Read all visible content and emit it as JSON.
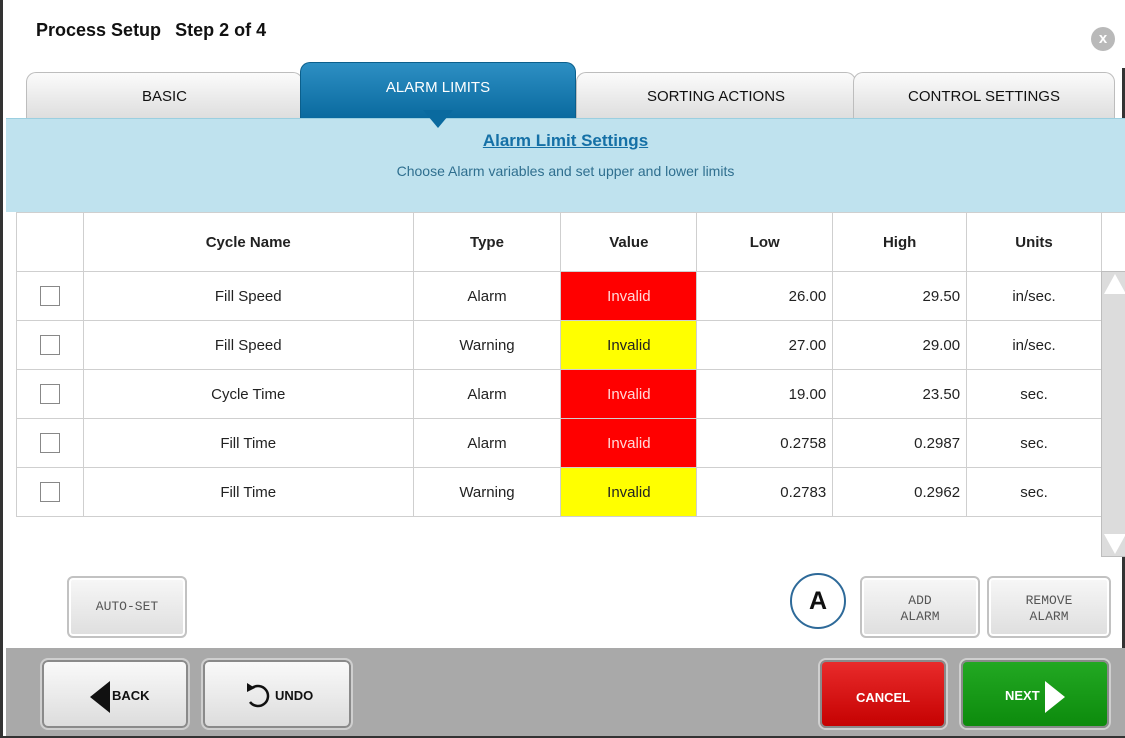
{
  "window": {
    "title": "Process Setup",
    "step": "Step 2 of 4",
    "close_label": "x"
  },
  "tabs": [
    {
      "label": "BASIC"
    },
    {
      "label": "ALARM LIMITS"
    },
    {
      "label": "SORTING ACTIONS"
    },
    {
      "label": "CONTROL SETTINGS"
    }
  ],
  "section": {
    "title": "Alarm Limit Settings",
    "subtitle": "Choose Alarm variables and set upper and lower limits"
  },
  "table": {
    "headers": [
      "",
      "Cycle Name",
      "Type",
      "Value",
      "Low",
      "High",
      "Units"
    ],
    "rows": [
      {
        "cycle": "Fill Speed",
        "type": "Alarm",
        "value": "Invalid",
        "low": "26.00",
        "high": "29.50",
        "units": "in/sec."
      },
      {
        "cycle": "Fill Speed",
        "type": "Warning",
        "value": "Invalid",
        "low": "27.00",
        "high": "29.00",
        "units": "in/sec."
      },
      {
        "cycle": "Cycle Time",
        "type": "Alarm",
        "value": "Invalid",
        "low": "19.00",
        "high": "23.50",
        "units": "sec."
      },
      {
        "cycle": "Fill Time",
        "type": "Alarm",
        "value": "Invalid",
        "low": "0.2758",
        "high": "0.2987",
        "units": "sec."
      },
      {
        "cycle": "Fill Time",
        "type": "Warning",
        "value": "Invalid",
        "low": "0.2783",
        "high": "0.2962",
        "units": "sec."
      }
    ]
  },
  "actions": {
    "auto_set": "AUTO-SET",
    "add_alarm": [
      "ADD",
      "ALARM"
    ],
    "remove_alarm": [
      "REMOVE",
      "ALARM"
    ],
    "marker": "A"
  },
  "footer": {
    "back": "BACK",
    "undo": "UNDO",
    "cancel": "CANCEL",
    "next": "NEXT"
  },
  "colors": {
    "alarm_value_bg": "#ff0000",
    "warning_value_bg": "#ffff00",
    "active_tab": "#0a6a9f",
    "band_bg": "#bfe2ee"
  },
  "icons": {
    "close": "close-icon",
    "back": "back-arrow-icon",
    "undo": "undo-icon",
    "next": "next-arrow-icon"
  }
}
